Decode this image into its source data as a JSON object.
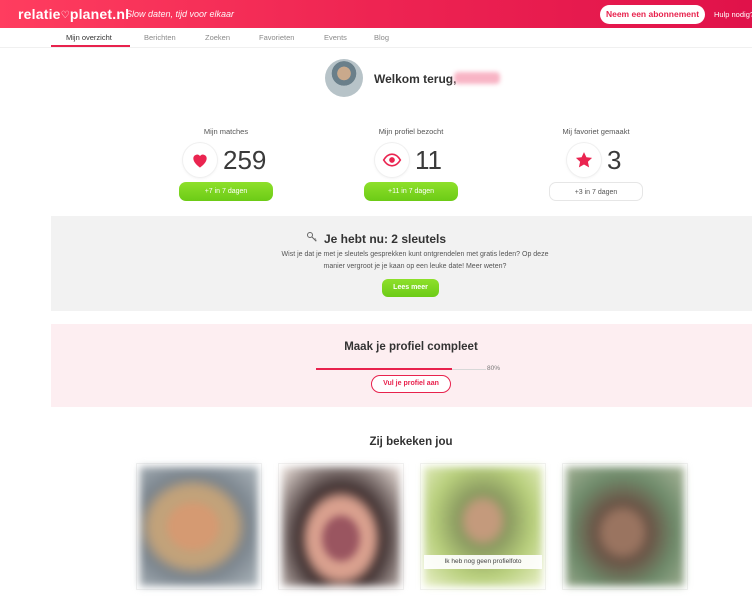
{
  "header": {
    "logo_main": "relatie",
    "logo_end": "planet.nl",
    "tagline": "Slow daten, tijd voor elkaar",
    "subscribe_label": "Neem een abonnement",
    "help_label": "Hulp nodig?"
  },
  "tabs": [
    {
      "label": "Mijn overzicht",
      "active": true
    },
    {
      "label": "Berichten"
    },
    {
      "label": "Zoeken"
    },
    {
      "label": "Favorieten"
    },
    {
      "label": "Events"
    },
    {
      "label": "Blog"
    }
  ],
  "welcome": {
    "text": "Welkom terug,"
  },
  "stats": [
    {
      "label": "Mijn matches",
      "value": "259",
      "pill": "+7 in 7 dagen",
      "icon": "heart-icon"
    },
    {
      "label": "Mijn profiel bezocht",
      "value": "11",
      "pill": "+11 in 7 dagen",
      "icon": "eye-icon"
    },
    {
      "label": "Mij favoriet gemaakt",
      "value": "3",
      "pill": "+3 in 7 dagen",
      "icon": "star-icon"
    }
  ],
  "keys": {
    "title": "Je hebt nu: 2 sleutels",
    "text": "Wist je dat je met je sleutels gesprekken kunt ontgrendelen met gratis leden? Op deze manier vergroot je je kaan op een leuke date! Meer weten?",
    "button": "Lees meer"
  },
  "profile": {
    "title": "Maak je profiel compleet",
    "progress": 0.8,
    "progress_text": "80%",
    "button": "Vul je profiel aan"
  },
  "viewed": {
    "title": "Zij bekeken jou",
    "photos": [
      {
        "caption": ""
      },
      {
        "caption": ""
      },
      {
        "caption": "Ik heb nog geen profielfoto"
      },
      {
        "caption": ""
      }
    ]
  },
  "colors": {
    "brand": "#e8224d",
    "green": "#7ad321",
    "pink_bg": "#fdeef1"
  }
}
